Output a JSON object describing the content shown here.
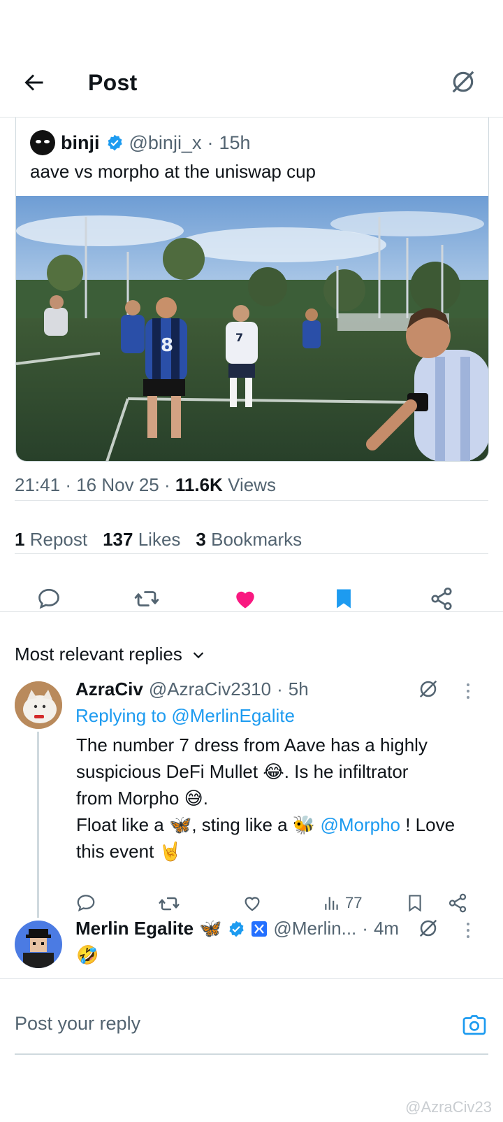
{
  "header": {
    "title": "Post"
  },
  "quoted": {
    "name": "binji",
    "handle": "@binji_x",
    "sep": "·",
    "time": "15h",
    "text": "aave vs morpho at the uniswap cup"
  },
  "meta": {
    "time": "21:41",
    "sep1": "·",
    "date": "16 Nov 25",
    "sep2": "·",
    "views_count": "11.6K",
    "views_label": "Views"
  },
  "stats": {
    "reposts_count": "1",
    "reposts_label": "Repost",
    "likes_count": "137",
    "likes_label": "Likes",
    "bookmarks_count": "3",
    "bookmarks_label": "Bookmarks"
  },
  "actions": {
    "liked": true,
    "bookmarked": true,
    "accent": "#f91880",
    "blue": "#1d9bf0"
  },
  "sort": {
    "label": "Most relevant replies"
  },
  "replies": [
    {
      "name": "AzraCiv",
      "handle": "@AzraCiv2310",
      "sep": "·",
      "time": "5h",
      "replying_prefix": "Replying to",
      "replying_to": "@MerlinEgalite",
      "line1": "The number 7 dress from Aave has a highly",
      "line2a": "suspicious DeFi Mullet ",
      "emoji1": "😂",
      "line2b": ". Is he infiltrator",
      "line3a": "from Morpho ",
      "emoji2": "😅",
      "line3b": ".",
      "line4a": "Float like a ",
      "emoji3": "🦋",
      "line4b": ", sting like a ",
      "emoji4": "🐝",
      "line4c": " ",
      "mention": "@Morpho",
      "line4d": " ! Love",
      "line5a": "this event ",
      "emoji5": "🤘",
      "views": "77"
    },
    {
      "name": "Merlin Egalite",
      "name_emoji": "🦋",
      "handle": "@Merlin...",
      "sep": "·",
      "time": "4m",
      "text": "🤣"
    }
  ],
  "composer": {
    "placeholder": "Post your reply"
  },
  "watermark": "@AzraCiv23"
}
